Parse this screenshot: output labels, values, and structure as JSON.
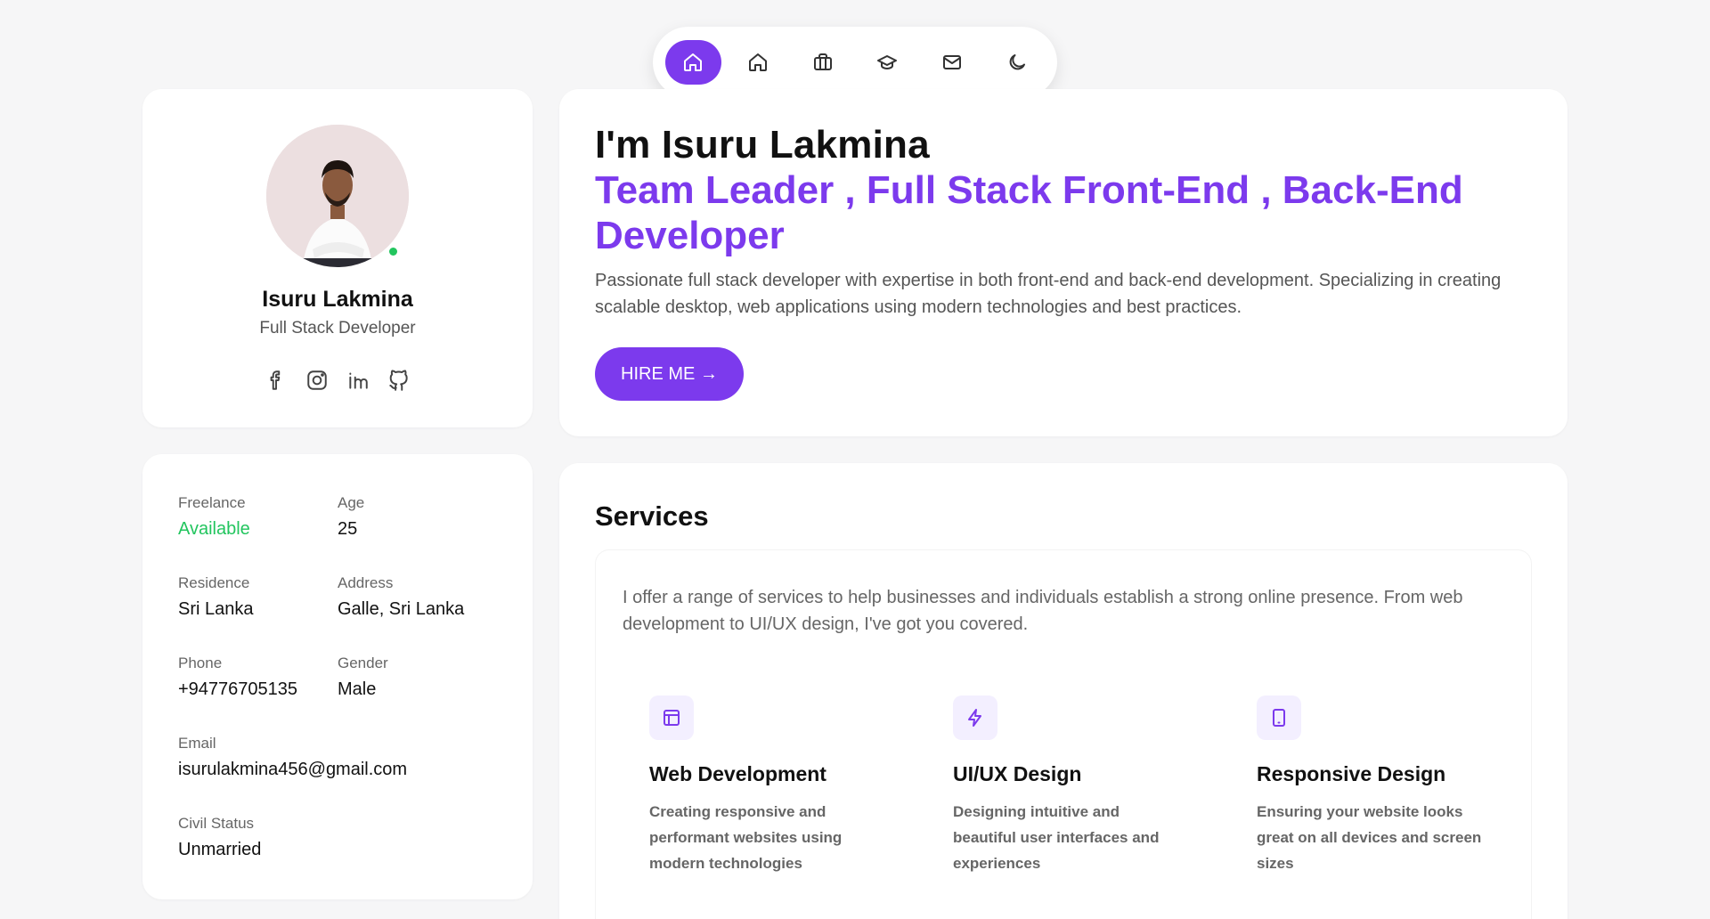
{
  "nav": {
    "items": [
      {
        "icon": "home-icon",
        "active": true
      },
      {
        "icon": "home-icon",
        "active": false
      },
      {
        "icon": "briefcase-icon",
        "active": false
      },
      {
        "icon": "graduation-cap-icon",
        "active": false
      },
      {
        "icon": "mail-icon",
        "active": false
      },
      {
        "icon": "moon-icon",
        "active": false
      }
    ]
  },
  "profile": {
    "name": "Isuru Lakmina",
    "role": "Full Stack Developer",
    "status_color": "#22c55e",
    "socials": [
      "facebook-icon",
      "instagram-icon",
      "linkedin-icon",
      "github-icon"
    ]
  },
  "info": {
    "freelance_label": "Freelance",
    "freelance_value": "Available",
    "age_label": "Age",
    "age_value": "25",
    "residence_label": "Residence",
    "residence_value": "Sri Lanka",
    "address_label": "Address",
    "address_value": "Galle, Sri Lanka",
    "phone_label": "Phone",
    "phone_value": "+94776705135",
    "gender_label": "Gender",
    "gender_value": "Male",
    "email_label": "Email",
    "email_value": "isurulakmina456@gmail.com",
    "civil_label": "Civil Status",
    "civil_value": "Unmarried"
  },
  "hero": {
    "title": "I'm Isuru Lakmina",
    "subtitle": "Team Leader , Full Stack Front-End , Back-End Developer",
    "description": "Passionate full stack developer with expertise in both front-end and back-end development. Specializing in creating scalable desktop, web applications using modern technologies and best practices.",
    "hire_label": "HIRE ME →"
  },
  "services": {
    "title": "Services",
    "description": "I offer a range of services to help businesses and individuals establish a strong online presence. From web development to UI/UX design, I've got you covered.",
    "items": [
      {
        "icon": "layout-icon",
        "title": "Web Development",
        "description": "Creating responsive and performant websites using modern technologies"
      },
      {
        "icon": "zap-icon",
        "title": "UI/UX Design",
        "description": "Designing intuitive and beautiful user interfaces and experiences"
      },
      {
        "icon": "tablet-icon",
        "title": "Responsive Design",
        "description": "Ensuring your website looks great on all devices and screen sizes"
      }
    ]
  },
  "colors": {
    "accent": "#7c3aed",
    "available": "#22c55e",
    "background": "#f6f6f7"
  }
}
